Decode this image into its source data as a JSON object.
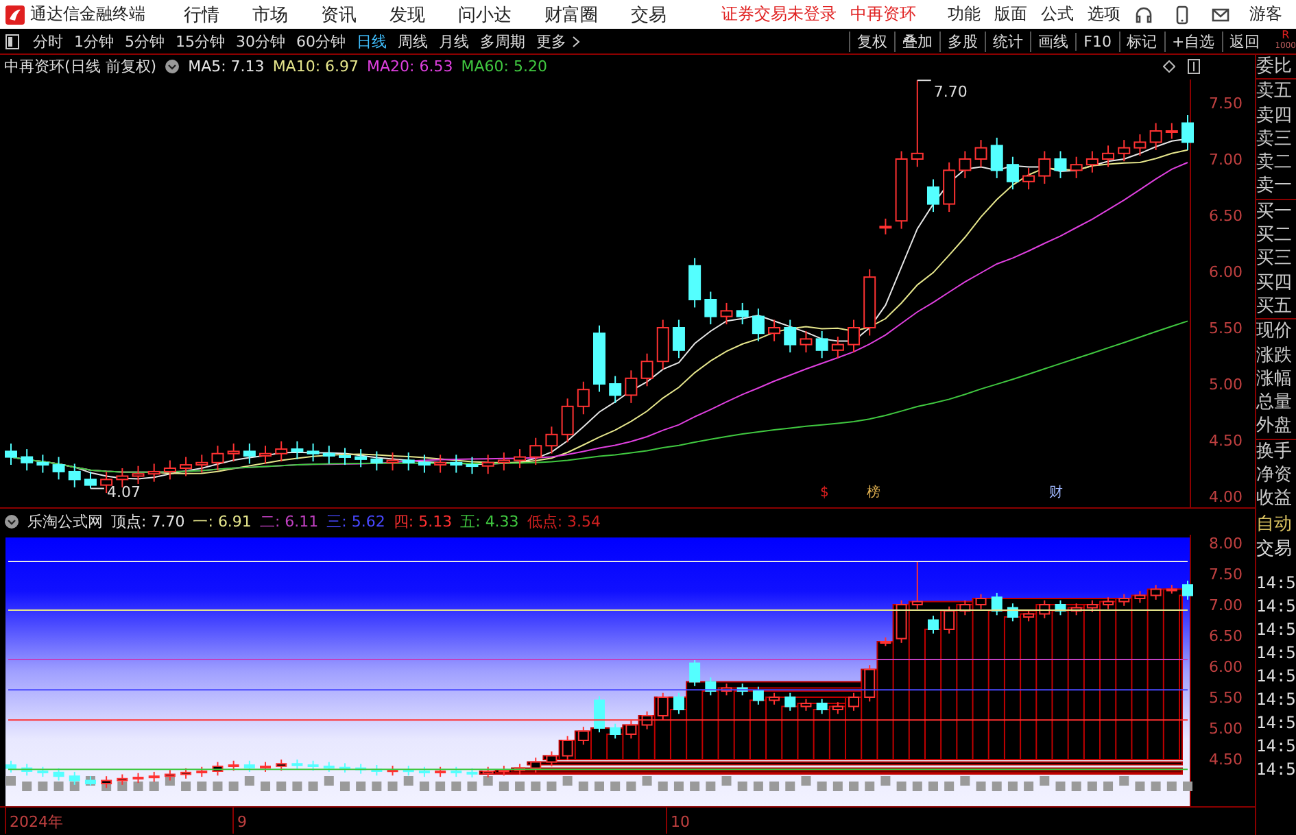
{
  "title_bar": {
    "app_name": "通达信金融终端",
    "menus": [
      "行情",
      "市场",
      "资讯",
      "发现",
      "问小达",
      "财富圈",
      "交易"
    ],
    "notice": "证券交易未登录",
    "stock": "中再资环",
    "right_menus": [
      "功能",
      "版面",
      "公式",
      "选项"
    ],
    "user": "游客"
  },
  "toolbar": {
    "periods": [
      {
        "label": "分时",
        "selected": false
      },
      {
        "label": "1分钟",
        "selected": false
      },
      {
        "label": "5分钟",
        "selected": false
      },
      {
        "label": "15分钟",
        "selected": false
      },
      {
        "label": "30分钟",
        "selected": false
      },
      {
        "label": "60分钟",
        "selected": false
      },
      {
        "label": "日线",
        "selected": true
      },
      {
        "label": "周线",
        "selected": false
      },
      {
        "label": "月线",
        "selected": false
      },
      {
        "label": "多周期",
        "selected": false
      },
      {
        "label": "更多",
        "selected": false
      }
    ],
    "buttons": [
      "复权",
      "叠加",
      "多股",
      "统计",
      "画线",
      "F10",
      "标记",
      "+自选",
      "返回"
    ],
    "corner": {
      "label": "R",
      "value": "1000"
    }
  },
  "main_chart": {
    "title": "中再资环(日线 前复权)",
    "indicators": [
      {
        "label": "MA5: 7.13",
        "color": "#e6e6e6"
      },
      {
        "label": "MA10: 6.97",
        "color": "#e6e68c"
      },
      {
        "label": "MA20: 6.53",
        "color": "#e040e0"
      },
      {
        "label": "MA60: 5.20",
        "color": "#40c840"
      }
    ],
    "price_axis": [
      "7.50",
      "7.00",
      "6.50",
      "6.00",
      "5.50",
      "5.00",
      "4.50",
      "4.00"
    ],
    "high_label": "7.70",
    "low_label": "4.07",
    "event_markers": [
      {
        "text": "$",
        "color": "#e02020"
      },
      {
        "text": "榜",
        "color": "#e0b050"
      },
      {
        "text": "财",
        "color": "#a0b8ff"
      }
    ]
  },
  "indicator_panel": {
    "name": "乐淘公式网",
    "levels": [
      {
        "label": "顶点:",
        "value": "7.70",
        "color": "#e6e6e6"
      },
      {
        "label": "一:",
        "value": "6.91",
        "color": "#e6e68c"
      },
      {
        "label": "二:",
        "value": "6.11",
        "color": "#c040c0"
      },
      {
        "label": "三:",
        "value": "5.62",
        "color": "#4848ff"
      },
      {
        "label": "四:",
        "value": "5.13",
        "color": "#ff3030"
      },
      {
        "label": "五:",
        "value": "4.33",
        "color": "#40c840"
      },
      {
        "label": "低点:",
        "value": "3.54",
        "color": "#d02020"
      }
    ],
    "price_axis": [
      "8.00",
      "7.50",
      "7.00",
      "6.50",
      "6.00",
      "5.50",
      "5.00",
      "4.50"
    ]
  },
  "date_axis": [
    "2024年",
    "9",
    "10"
  ],
  "quote_panel": {
    "fields": [
      "委比",
      "卖五",
      "卖四",
      "卖三",
      "卖二",
      "卖一",
      "买一",
      "买二",
      "买三",
      "买四",
      "买五",
      "现价",
      "涨跌",
      "涨幅",
      "总量",
      "外盘",
      "换手",
      "净资",
      "收益"
    ],
    "trade_labels": [
      "自动",
      "交易"
    ],
    "times": [
      "14:5",
      "14:5",
      "14:5",
      "14:5",
      "14:5",
      "14:5",
      "14:5",
      "14:5",
      "14:5"
    ]
  }
}
